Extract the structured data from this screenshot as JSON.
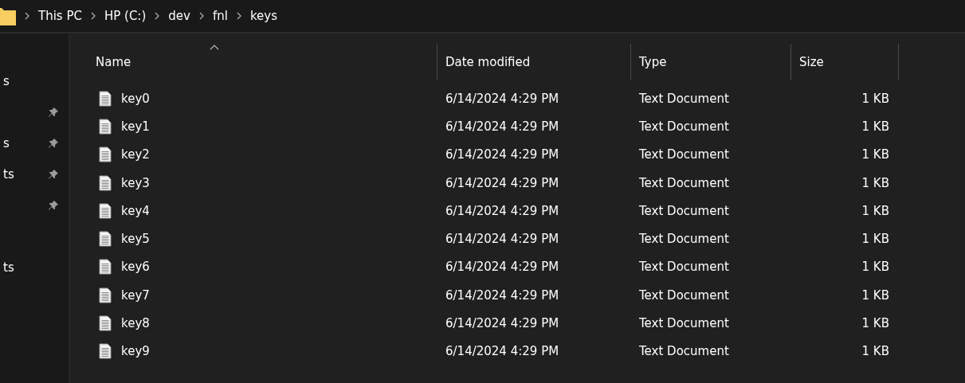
{
  "breadcrumb": [
    "This PC",
    "HP (C:)",
    "dev",
    "fnl",
    "keys"
  ],
  "sidebar": {
    "items": [
      {
        "label": "s",
        "pinned": false
      },
      {
        "pinned": true
      },
      {
        "label": "s",
        "pinned": true
      },
      {
        "label": "ts",
        "pinned": true
      },
      {
        "pinned": true
      },
      {
        "pinned": false
      },
      {
        "label": "ts",
        "pinned": false
      }
    ]
  },
  "table": {
    "columns": [
      {
        "label": "Name",
        "sorted": true
      },
      {
        "label": "Date modified",
        "sorted": false
      },
      {
        "label": "Type",
        "sorted": false
      },
      {
        "label": "Size",
        "sorted": false
      }
    ],
    "rows": [
      {
        "name": "key0",
        "date": "6/14/2024 4:29 PM",
        "type": "Text Document",
        "size": "1 KB"
      },
      {
        "name": "key1",
        "date": "6/14/2024 4:29 PM",
        "type": "Text Document",
        "size": "1 KB"
      },
      {
        "name": "key2",
        "date": "6/14/2024 4:29 PM",
        "type": "Text Document",
        "size": "1 KB"
      },
      {
        "name": "key3",
        "date": "6/14/2024 4:29 PM",
        "type": "Text Document",
        "size": "1 KB"
      },
      {
        "name": "key4",
        "date": "6/14/2024 4:29 PM",
        "type": "Text Document",
        "size": "1 KB"
      },
      {
        "name": "key5",
        "date": "6/14/2024 4:29 PM",
        "type": "Text Document",
        "size": "1 KB"
      },
      {
        "name": "key6",
        "date": "6/14/2024 4:29 PM",
        "type": "Text Document",
        "size": "1 KB"
      },
      {
        "name": "key7",
        "date": "6/14/2024 4:29 PM",
        "type": "Text Document",
        "size": "1 KB"
      },
      {
        "name": "key8",
        "date": "6/14/2024 4:29 PM",
        "type": "Text Document",
        "size": "1 KB"
      },
      {
        "name": "key9",
        "date": "6/14/2024 4:29 PM",
        "type": "Text Document",
        "size": "1 KB"
      }
    ]
  }
}
